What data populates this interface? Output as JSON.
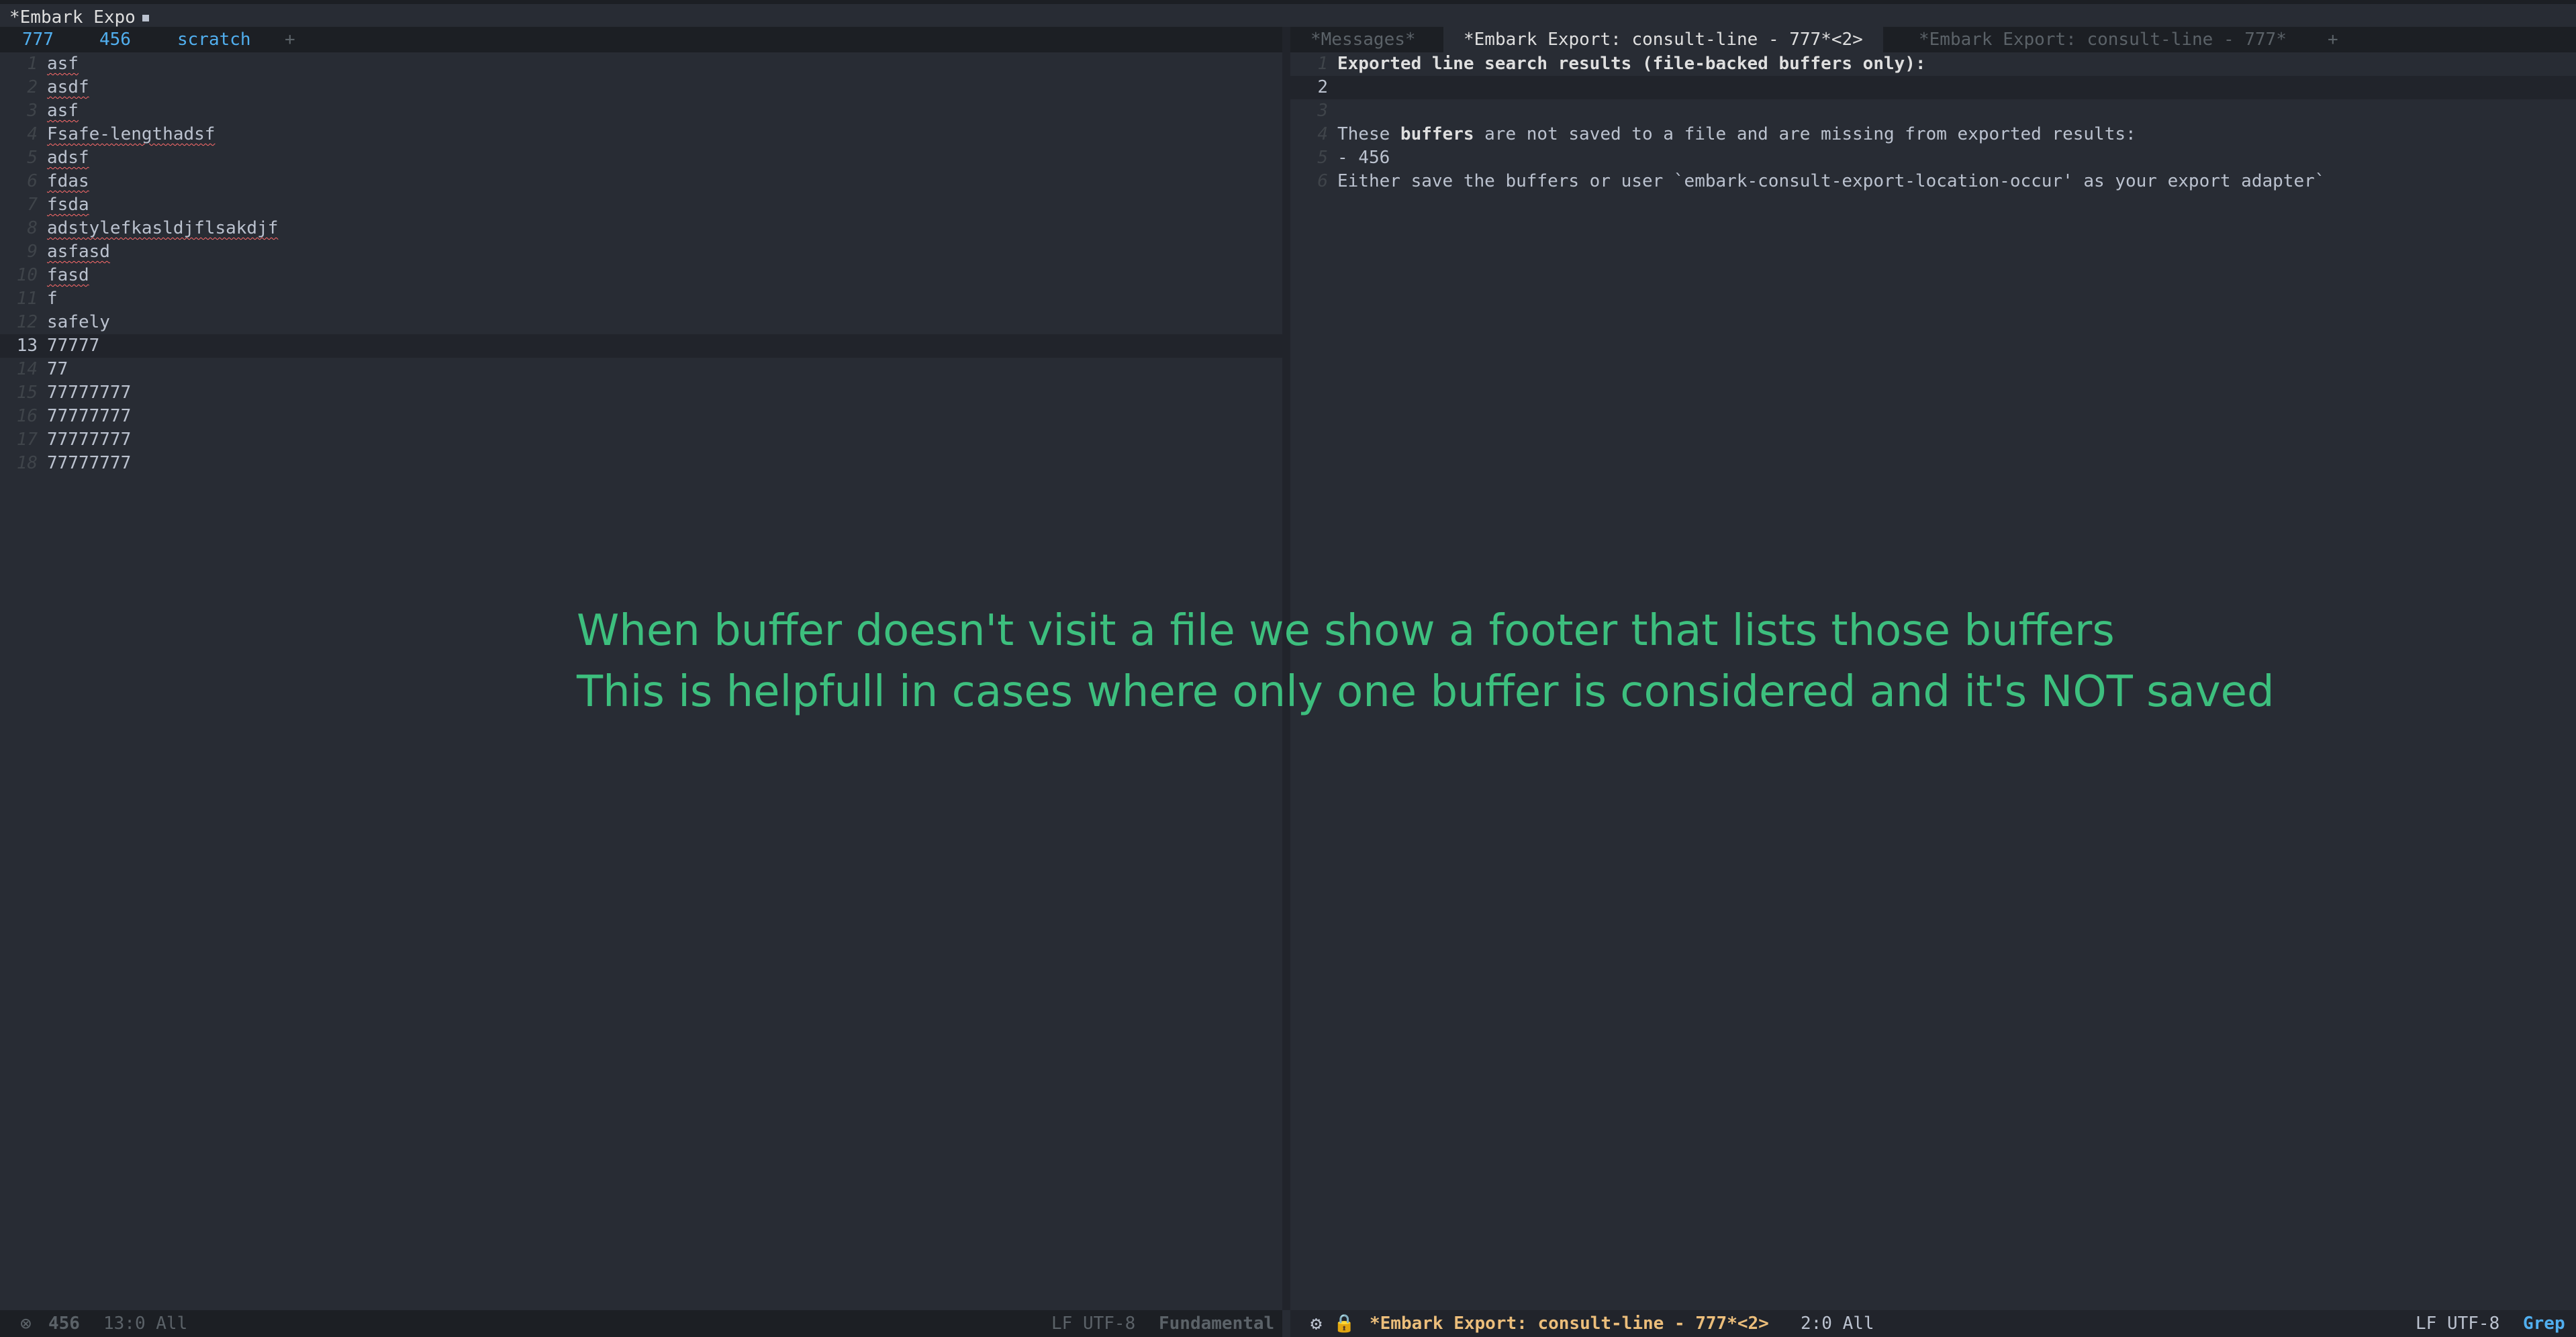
{
  "frame": {
    "title": "*Embark Expo"
  },
  "left": {
    "tabs": [
      {
        "label": "777"
      },
      {
        "label": "456"
      },
      {
        "label": "scratch"
      },
      {
        "label": "+"
      }
    ],
    "lines": [
      {
        "num": "1",
        "text": "asf"
      },
      {
        "num": "2",
        "text": "asdf"
      },
      {
        "num": "3",
        "text": "asf"
      },
      {
        "num": "4",
        "text": "Fsafe-lengthadsf"
      },
      {
        "num": "5",
        "text": "adsf"
      },
      {
        "num": "6",
        "text": "fdas"
      },
      {
        "num": "7",
        "text": "fsda"
      },
      {
        "num": "8",
        "text": "adstylefkasldjflsakdjf"
      },
      {
        "num": "9",
        "text": "asfasd"
      },
      {
        "num": "10",
        "text": "fasd"
      },
      {
        "num": "11",
        "text": "f"
      },
      {
        "num": "12",
        "text": "safely"
      },
      {
        "num": "13",
        "text": "77777"
      },
      {
        "num": "14",
        "text": "77"
      },
      {
        "num": "15",
        "text": "77777777"
      },
      {
        "num": "16",
        "text": "77777777"
      },
      {
        "num": "17",
        "text": "77777777"
      },
      {
        "num": "18",
        "text": "77777777"
      }
    ],
    "modeline": {
      "buffer": "456",
      "position": "13:0 All",
      "encoding": "LF UTF-8",
      "mode": "Fundamental"
    }
  },
  "right": {
    "tabs": [
      {
        "label": "*Messages*"
      },
      {
        "label": "*Embark Export: consult-line - 777*<2>"
      },
      {
        "label": "*Embark Export: consult-line - 777*"
      },
      {
        "label": "+"
      }
    ],
    "lines": [
      {
        "num": "1",
        "text": "Exported line search results (file-backed buffers only):"
      },
      {
        "num": "2",
        "text": ""
      },
      {
        "num": "3",
        "text": ""
      },
      {
        "num": "4",
        "before": "These ",
        "bold": "buffers",
        "after": " are not saved to a file and are missing from exported results:"
      },
      {
        "num": "5",
        "text": "- 456"
      },
      {
        "num": "6",
        "text": "Either save the buffers or user `embark-consult-export-location-occur' as your export adapter`"
      }
    ],
    "modeline": {
      "buffer": "*Embark Export: consult-line - 777*<2>",
      "position": "2:0 All",
      "encoding": "LF UTF-8",
      "mode": "Grep"
    }
  },
  "annotation": {
    "line1": "When buffer doesn't visit a file we show a footer that lists those buffers",
    "line2": "This is helpfull in cases where only one buffer is considered and it's NOT saved"
  },
  "colors": {
    "background": "#282c34",
    "annotation": "#3dbf7e",
    "accent": "#51afef",
    "buffer_name": "#ECBE7B"
  }
}
